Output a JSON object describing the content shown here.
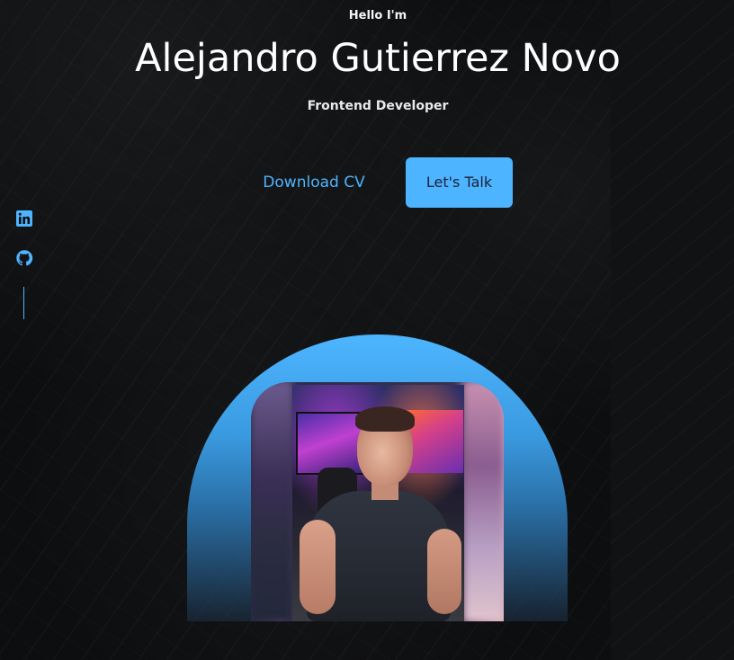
{
  "hero": {
    "greeting": "Hello I'm",
    "name": "Alejandro Gutierrez Novo",
    "role": "Frontend Developer"
  },
  "cta": {
    "download_label": "Download CV",
    "talk_label": "Let's Talk"
  },
  "socials": [
    {
      "icon": "linkedin-icon"
    },
    {
      "icon": "github-icon"
    }
  ],
  "colors": {
    "accent": "#4db5ff",
    "background": "#0d0e10",
    "button_text": "#1f1f38"
  }
}
